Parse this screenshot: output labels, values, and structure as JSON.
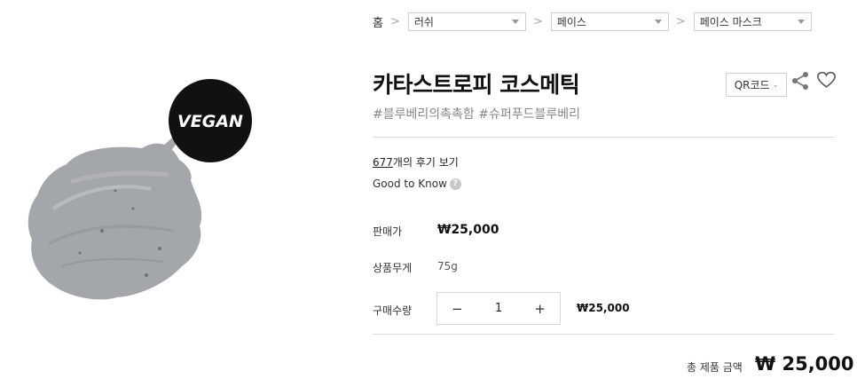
{
  "breadcrumb": {
    "home": "홈",
    "separator": ">",
    "selects": [
      {
        "value": "러쉬"
      },
      {
        "value": "페이스"
      },
      {
        "value": "페이스 마스크"
      }
    ]
  },
  "product": {
    "title": "카타스트로피 코스메틱",
    "tags": "#블루베리의촉촉함 #슈퍼푸드블루베리",
    "badge": "VEGAN",
    "qr_label": "QR코드",
    "reviews_count": "677",
    "reviews_suffix": "개의 후기 보기",
    "good_to_know": "Good to Know",
    "help_glyph": "?"
  },
  "details": {
    "price_label": "판매가",
    "price_value": "₩25,000",
    "weight_label": "상품무게",
    "weight_value": "75g",
    "quantity_label": "구매수량",
    "quantity": "1",
    "minus": "−",
    "plus": "+",
    "line_price": "₩25,000"
  },
  "total": {
    "label": "총 제품 금액",
    "value": "₩ 25,000"
  },
  "colors": {
    "badge_bg": "#111111",
    "clay": "#a3a6aa"
  },
  "icons": [
    "chevron-right-icon",
    "caret-down-icon",
    "share-icon",
    "heart-icon",
    "help-icon"
  ]
}
